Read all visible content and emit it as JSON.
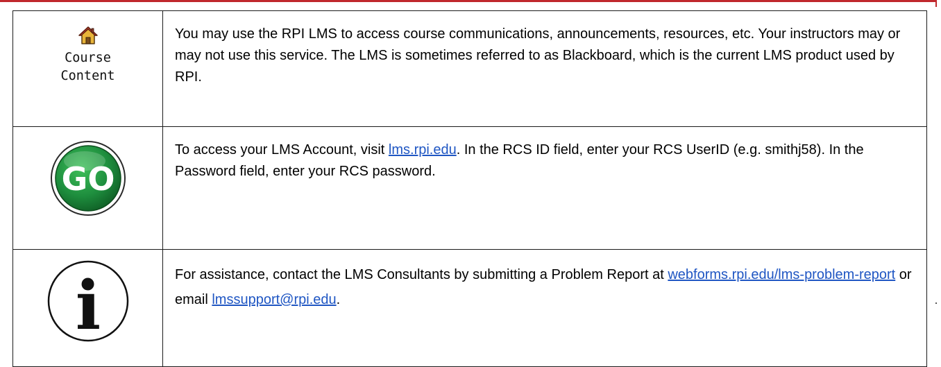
{
  "rows": [
    {
      "icon": "home-icon",
      "icon_label": "Course\nContent",
      "text": "You may use the RPI LMS to access course communications, announcements, resources, etc. Your instructors may or may not use this service. The LMS is sometimes referred to as Blackboard, which is the current LMS product used by RPI."
    },
    {
      "icon": "go-icon",
      "icon_text": "GO",
      "text_before": "To access your LMS Account, visit ",
      "link": "lms.rpi.edu",
      "text_after": ". In the RCS ID field, enter your RCS UserID (e.g. smithj58). In the Password field, enter your RCS password."
    },
    {
      "icon": "info-icon",
      "icon_text": "i",
      "text_before": "For assistance, contact the LMS Consultants by submitting a Problem Report at ",
      "link": "webforms.rpi.edu/lms-problem-report",
      "text_middle": " or email ",
      "link2": "lmssupport@rpi.edu",
      "text_after": "."
    }
  ],
  "colors": {
    "accent_rule": "#c0282d",
    "link": "#1f56c3",
    "go_green": "#1e8e3e"
  }
}
